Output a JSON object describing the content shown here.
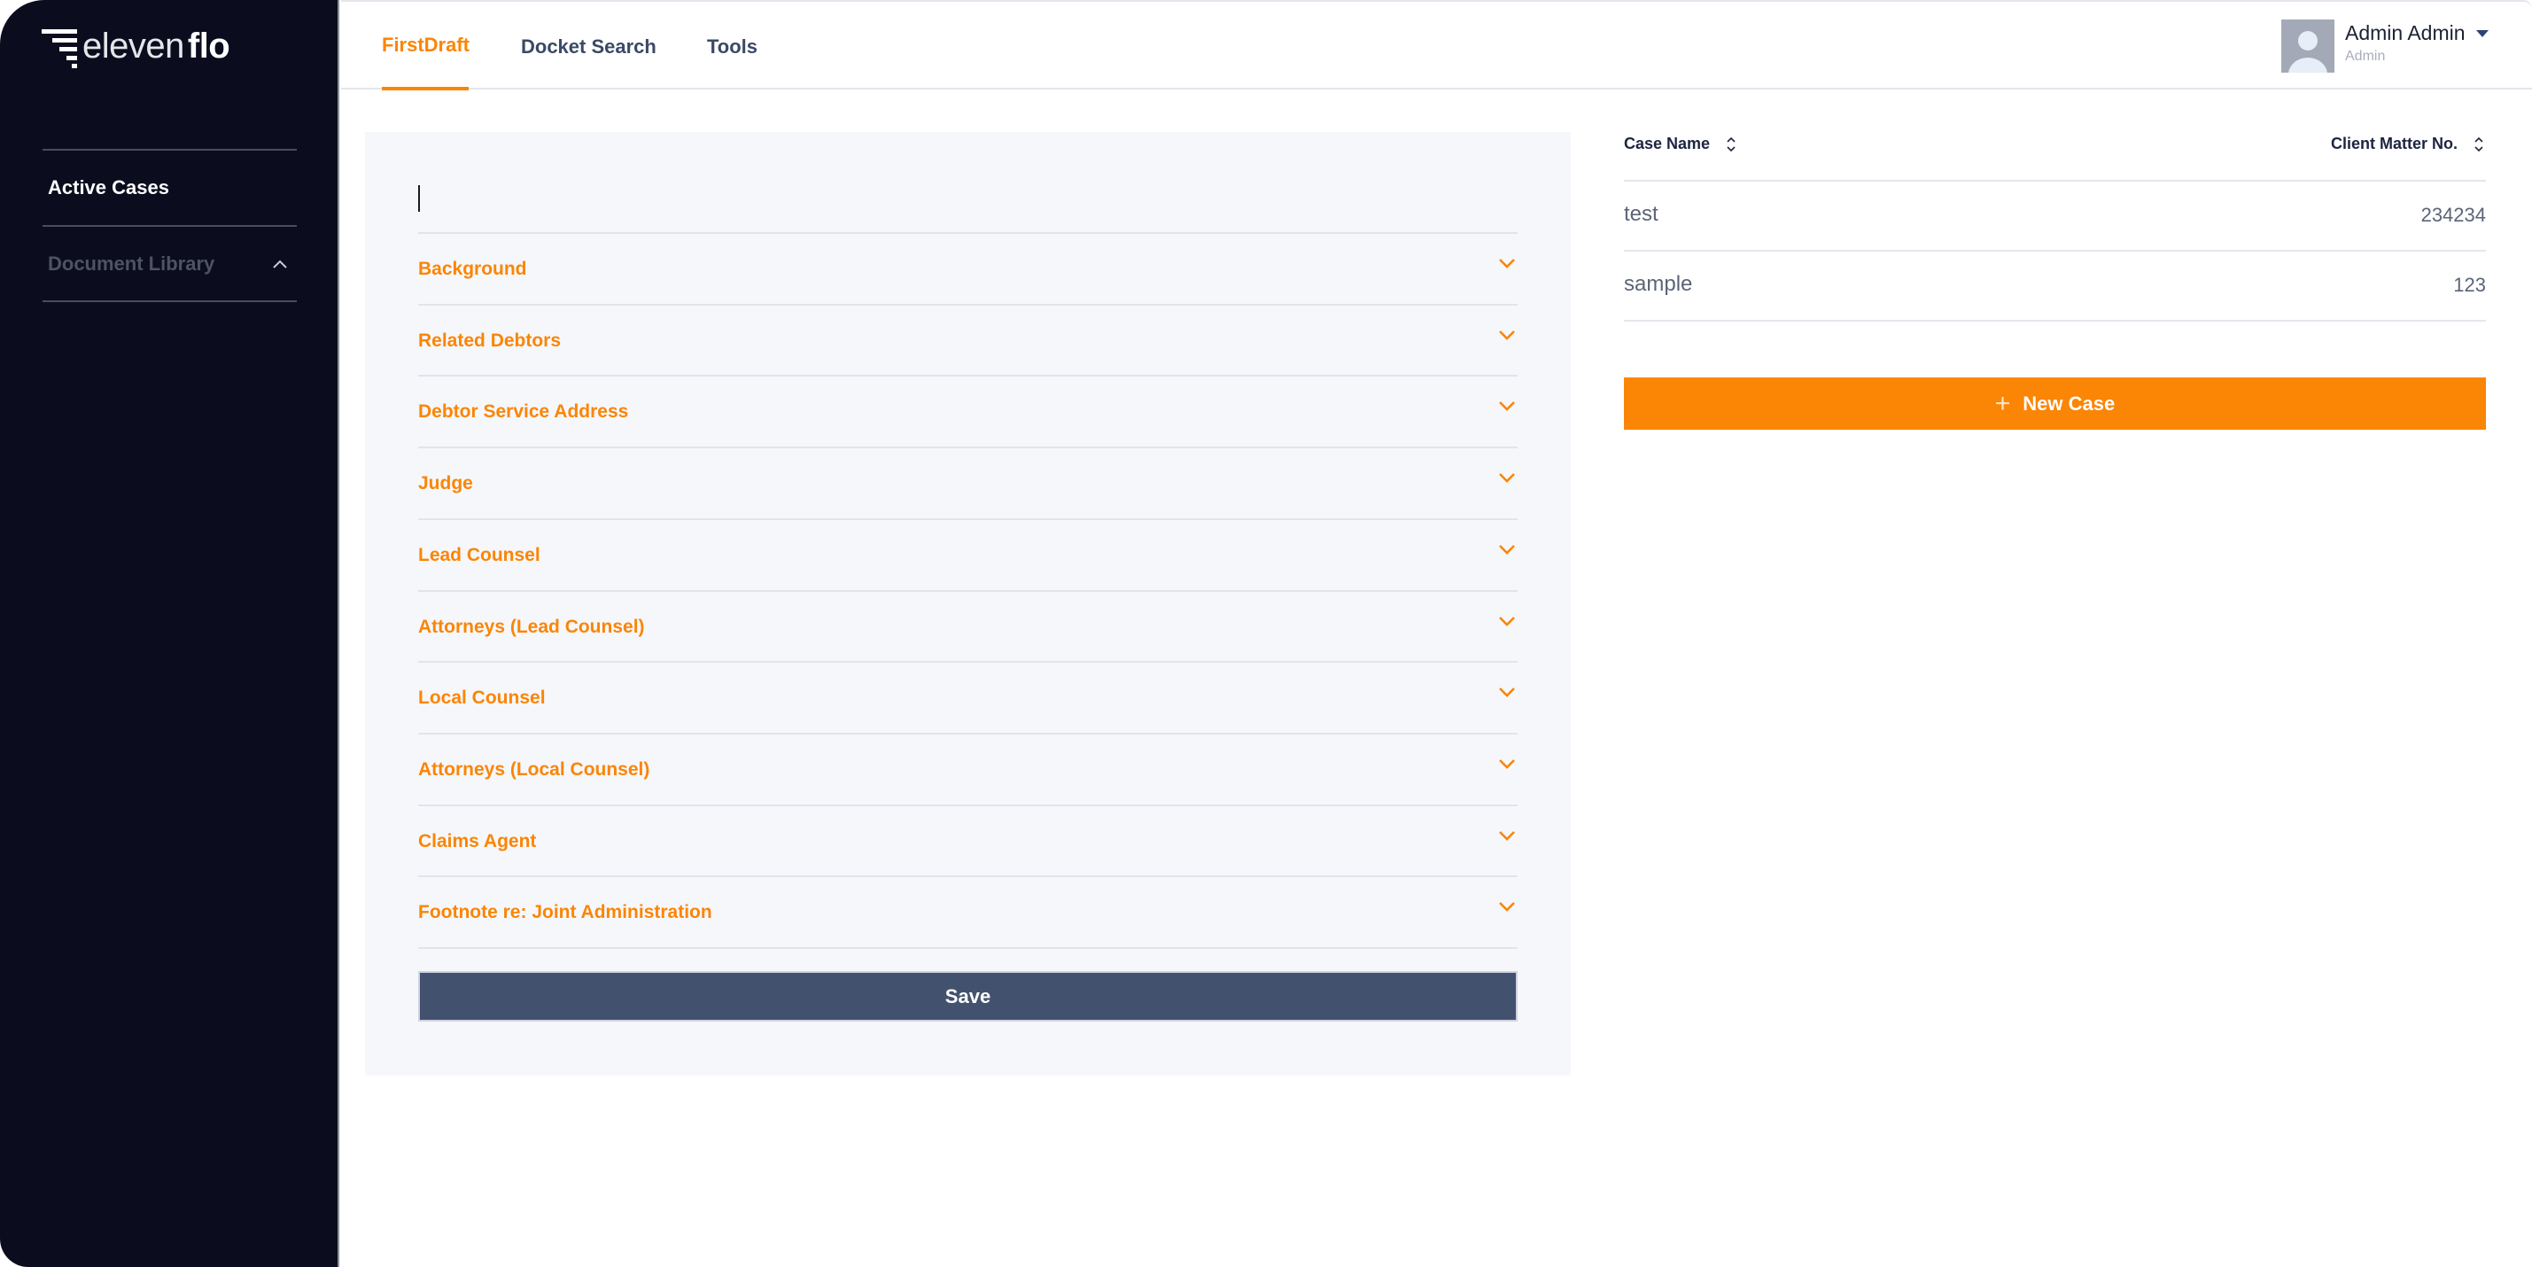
{
  "app": {
    "brand_light": "eleven",
    "brand_bold": "flo",
    "logo_icon": "stepped-bars-icon"
  },
  "colors": {
    "accent": "#fb8505",
    "sidebar_bg": "#0b0d1f",
    "save_button": "#42526e",
    "panel_bg": "#f6f7fb"
  },
  "sidebar": {
    "items": [
      {
        "label": "Active Cases",
        "active": true
      },
      {
        "label": "Document Library",
        "active": false,
        "icon": "chevron-up-icon"
      }
    ]
  },
  "header": {
    "tabs": [
      {
        "label": "FirstDraft",
        "active": true
      },
      {
        "label": "Docket Search",
        "active": false
      },
      {
        "label": "Tools",
        "active": false
      }
    ],
    "user": {
      "name": "Admin Admin",
      "role": "Admin",
      "icon": "caret-down-icon"
    }
  },
  "form": {
    "input_value": "",
    "sections": [
      {
        "label": "Background"
      },
      {
        "label": "Related Debtors"
      },
      {
        "label": "Debtor Service Address"
      },
      {
        "label": "Judge"
      },
      {
        "label": "Lead Counsel"
      },
      {
        "label": "Attorneys (Lead Counsel)"
      },
      {
        "label": "Local Counsel"
      },
      {
        "label": "Attorneys (Local Counsel)"
      },
      {
        "label": "Claims Agent"
      },
      {
        "label": "Footnote re: Joint Administration"
      }
    ],
    "save_label": "Save"
  },
  "cases": {
    "columns": [
      "Case Name",
      "Client Matter No."
    ],
    "rows": [
      {
        "name": "test",
        "matter": "234234"
      },
      {
        "name": "sample",
        "matter": "123"
      }
    ],
    "new_case_label": "New Case"
  }
}
